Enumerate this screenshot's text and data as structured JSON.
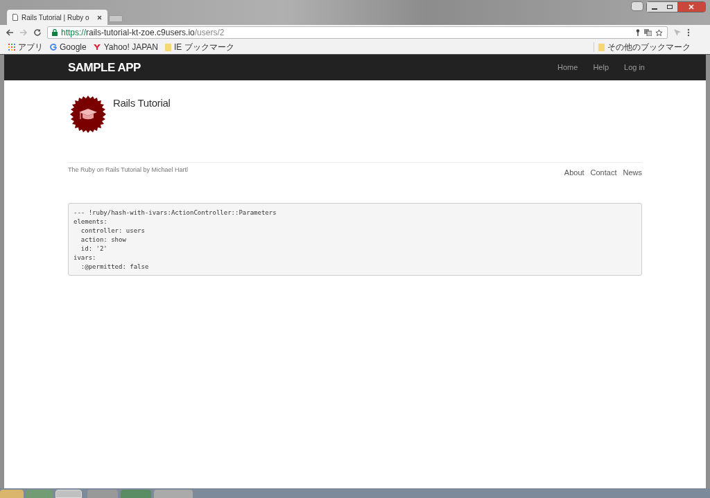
{
  "browser": {
    "tabs": [
      {
        "kind": "page",
        "title": "Rails Tutorial | Ruby o",
        "selected": true
      },
      {
        "kind": "new",
        "selected": false
      }
    ],
    "address": {
      "scheme": "https://",
      "host": "rails-tutorial-kt-zoe.c9users.io",
      "path": "/users/2",
      "secure": true
    },
    "bookmarks": [
      {
        "kind": "apps",
        "label": "アプリ"
      },
      {
        "kind": "google",
        "label": "Google"
      },
      {
        "kind": "yahoo",
        "label": "Yahoo! JAPAN"
      },
      {
        "kind": "folder",
        "label": "IE ブックマーク"
      }
    ],
    "other_bookmarks": "その他のブックマーク"
  },
  "navbar": {
    "logo": "SAMPLE APP",
    "links": [
      "Home",
      "Help",
      "Log in"
    ]
  },
  "user": {
    "name": "Rails Tutorial"
  },
  "footer": {
    "credit": "The Ruby on Rails Tutorial by Michael Hartl",
    "links": [
      "About",
      "Contact",
      "News"
    ]
  },
  "debug": {
    "lines": [
      "--- !ruby/hash-with-ivars:ActionController::Parameters",
      "elements:",
      "  controller: users",
      "  action: show",
      "  id: '2'",
      "ivars:",
      "  :@permitted: false"
    ]
  }
}
